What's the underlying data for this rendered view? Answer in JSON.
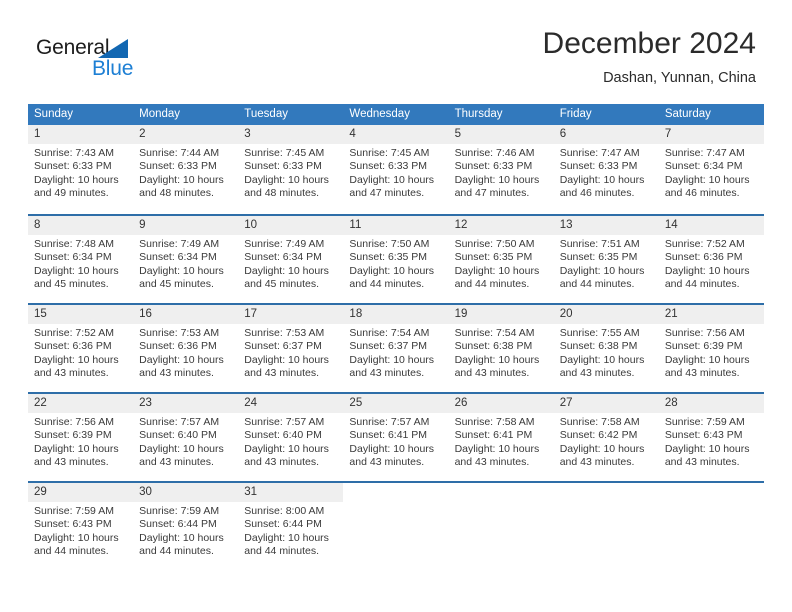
{
  "logo": {
    "word_one": "General",
    "word_two": "Blue",
    "triangle_icon": "triangle-icon",
    "brand_blue": "#1d7fd4",
    "brand_dark": "#1c1c1c"
  },
  "header": {
    "title": "December 2024",
    "subtitle": "Dashan, Yunnan, China"
  },
  "theme": {
    "header_bg": "#3279bd",
    "row_border": "#2e6ea8",
    "daynum_band": "#efefef"
  },
  "calendar": {
    "weekdays": [
      "Sunday",
      "Monday",
      "Tuesday",
      "Wednesday",
      "Thursday",
      "Friday",
      "Saturday"
    ],
    "weeks": [
      [
        {
          "day": "1",
          "sunrise": "Sunrise: 7:43 AM",
          "sunset": "Sunset: 6:33 PM",
          "daylight_line1": "Daylight: 10 hours",
          "daylight_line2": "and 49 minutes."
        },
        {
          "day": "2",
          "sunrise": "Sunrise: 7:44 AM",
          "sunset": "Sunset: 6:33 PM",
          "daylight_line1": "Daylight: 10 hours",
          "daylight_line2": "and 48 minutes."
        },
        {
          "day": "3",
          "sunrise": "Sunrise: 7:45 AM",
          "sunset": "Sunset: 6:33 PM",
          "daylight_line1": "Daylight: 10 hours",
          "daylight_line2": "and 48 minutes."
        },
        {
          "day": "4",
          "sunrise": "Sunrise: 7:45 AM",
          "sunset": "Sunset: 6:33 PM",
          "daylight_line1": "Daylight: 10 hours",
          "daylight_line2": "and 47 minutes."
        },
        {
          "day": "5",
          "sunrise": "Sunrise: 7:46 AM",
          "sunset": "Sunset: 6:33 PM",
          "daylight_line1": "Daylight: 10 hours",
          "daylight_line2": "and 47 minutes."
        },
        {
          "day": "6",
          "sunrise": "Sunrise: 7:47 AM",
          "sunset": "Sunset: 6:33 PM",
          "daylight_line1": "Daylight: 10 hours",
          "daylight_line2": "and 46 minutes."
        },
        {
          "day": "7",
          "sunrise": "Sunrise: 7:47 AM",
          "sunset": "Sunset: 6:34 PM",
          "daylight_line1": "Daylight: 10 hours",
          "daylight_line2": "and 46 minutes."
        }
      ],
      [
        {
          "day": "8",
          "sunrise": "Sunrise: 7:48 AM",
          "sunset": "Sunset: 6:34 PM",
          "daylight_line1": "Daylight: 10 hours",
          "daylight_line2": "and 45 minutes."
        },
        {
          "day": "9",
          "sunrise": "Sunrise: 7:49 AM",
          "sunset": "Sunset: 6:34 PM",
          "daylight_line1": "Daylight: 10 hours",
          "daylight_line2": "and 45 minutes."
        },
        {
          "day": "10",
          "sunrise": "Sunrise: 7:49 AM",
          "sunset": "Sunset: 6:34 PM",
          "daylight_line1": "Daylight: 10 hours",
          "daylight_line2": "and 45 minutes."
        },
        {
          "day": "11",
          "sunrise": "Sunrise: 7:50 AM",
          "sunset": "Sunset: 6:35 PM",
          "daylight_line1": "Daylight: 10 hours",
          "daylight_line2": "and 44 minutes."
        },
        {
          "day": "12",
          "sunrise": "Sunrise: 7:50 AM",
          "sunset": "Sunset: 6:35 PM",
          "daylight_line1": "Daylight: 10 hours",
          "daylight_line2": "and 44 minutes."
        },
        {
          "day": "13",
          "sunrise": "Sunrise: 7:51 AM",
          "sunset": "Sunset: 6:35 PM",
          "daylight_line1": "Daylight: 10 hours",
          "daylight_line2": "and 44 minutes."
        },
        {
          "day": "14",
          "sunrise": "Sunrise: 7:52 AM",
          "sunset": "Sunset: 6:36 PM",
          "daylight_line1": "Daylight: 10 hours",
          "daylight_line2": "and 44 minutes."
        }
      ],
      [
        {
          "day": "15",
          "sunrise": "Sunrise: 7:52 AM",
          "sunset": "Sunset: 6:36 PM",
          "daylight_line1": "Daylight: 10 hours",
          "daylight_line2": "and 43 minutes."
        },
        {
          "day": "16",
          "sunrise": "Sunrise: 7:53 AM",
          "sunset": "Sunset: 6:36 PM",
          "daylight_line1": "Daylight: 10 hours",
          "daylight_line2": "and 43 minutes."
        },
        {
          "day": "17",
          "sunrise": "Sunrise: 7:53 AM",
          "sunset": "Sunset: 6:37 PM",
          "daylight_line1": "Daylight: 10 hours",
          "daylight_line2": "and 43 minutes."
        },
        {
          "day": "18",
          "sunrise": "Sunrise: 7:54 AM",
          "sunset": "Sunset: 6:37 PM",
          "daylight_line1": "Daylight: 10 hours",
          "daylight_line2": "and 43 minutes."
        },
        {
          "day": "19",
          "sunrise": "Sunrise: 7:54 AM",
          "sunset": "Sunset: 6:38 PM",
          "daylight_line1": "Daylight: 10 hours",
          "daylight_line2": "and 43 minutes."
        },
        {
          "day": "20",
          "sunrise": "Sunrise: 7:55 AM",
          "sunset": "Sunset: 6:38 PM",
          "daylight_line1": "Daylight: 10 hours",
          "daylight_line2": "and 43 minutes."
        },
        {
          "day": "21",
          "sunrise": "Sunrise: 7:56 AM",
          "sunset": "Sunset: 6:39 PM",
          "daylight_line1": "Daylight: 10 hours",
          "daylight_line2": "and 43 minutes."
        }
      ],
      [
        {
          "day": "22",
          "sunrise": "Sunrise: 7:56 AM",
          "sunset": "Sunset: 6:39 PM",
          "daylight_line1": "Daylight: 10 hours",
          "daylight_line2": "and 43 minutes."
        },
        {
          "day": "23",
          "sunrise": "Sunrise: 7:57 AM",
          "sunset": "Sunset: 6:40 PM",
          "daylight_line1": "Daylight: 10 hours",
          "daylight_line2": "and 43 minutes."
        },
        {
          "day": "24",
          "sunrise": "Sunrise: 7:57 AM",
          "sunset": "Sunset: 6:40 PM",
          "daylight_line1": "Daylight: 10 hours",
          "daylight_line2": "and 43 minutes."
        },
        {
          "day": "25",
          "sunrise": "Sunrise: 7:57 AM",
          "sunset": "Sunset: 6:41 PM",
          "daylight_line1": "Daylight: 10 hours",
          "daylight_line2": "and 43 minutes."
        },
        {
          "day": "26",
          "sunrise": "Sunrise: 7:58 AM",
          "sunset": "Sunset: 6:41 PM",
          "daylight_line1": "Daylight: 10 hours",
          "daylight_line2": "and 43 minutes."
        },
        {
          "day": "27",
          "sunrise": "Sunrise: 7:58 AM",
          "sunset": "Sunset: 6:42 PM",
          "daylight_line1": "Daylight: 10 hours",
          "daylight_line2": "and 43 minutes."
        },
        {
          "day": "28",
          "sunrise": "Sunrise: 7:59 AM",
          "sunset": "Sunset: 6:43 PM",
          "daylight_line1": "Daylight: 10 hours",
          "daylight_line2": "and 43 minutes."
        }
      ],
      [
        {
          "day": "29",
          "sunrise": "Sunrise: 7:59 AM",
          "sunset": "Sunset: 6:43 PM",
          "daylight_line1": "Daylight: 10 hours",
          "daylight_line2": "and 44 minutes."
        },
        {
          "day": "30",
          "sunrise": "Sunrise: 7:59 AM",
          "sunset": "Sunset: 6:44 PM",
          "daylight_line1": "Daylight: 10 hours",
          "daylight_line2": "and 44 minutes."
        },
        {
          "day": "31",
          "sunrise": "Sunrise: 8:00 AM",
          "sunset": "Sunset: 6:44 PM",
          "daylight_line1": "Daylight: 10 hours",
          "daylight_line2": "and 44 minutes."
        },
        {
          "day": "",
          "sunrise": "",
          "sunset": "",
          "daylight_line1": "",
          "daylight_line2": ""
        },
        {
          "day": "",
          "sunrise": "",
          "sunset": "",
          "daylight_line1": "",
          "daylight_line2": ""
        },
        {
          "day": "",
          "sunrise": "",
          "sunset": "",
          "daylight_line1": "",
          "daylight_line2": ""
        },
        {
          "day": "",
          "sunrise": "",
          "sunset": "",
          "daylight_line1": "",
          "daylight_line2": ""
        }
      ]
    ]
  }
}
